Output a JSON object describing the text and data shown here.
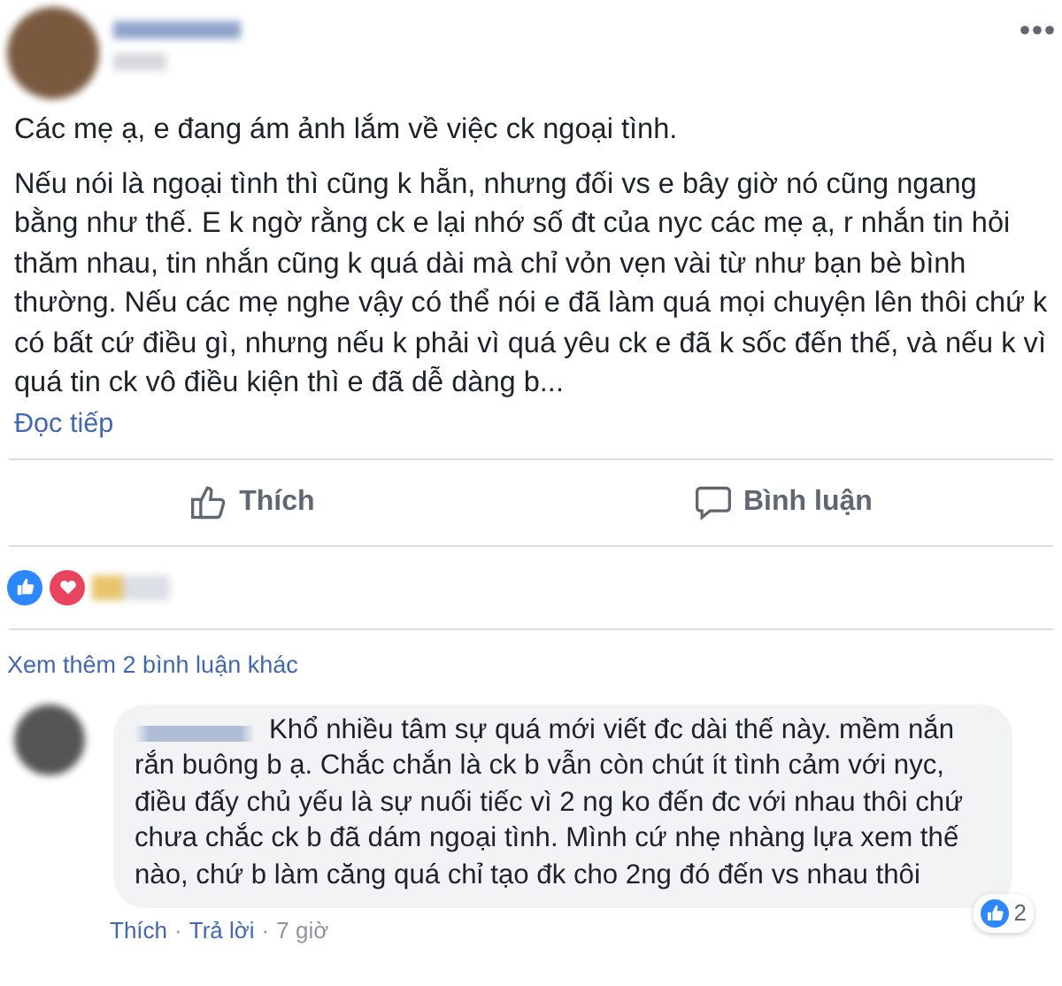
{
  "post": {
    "intro": "Các mẹ ạ, e đang ám ảnh lắm về việc ck ngoại tình.",
    "body": "Nếu nói là ngoại tình thì cũng k hẵn, nhưng đối vs e bây giờ nó cũng ngang bằng như thế. E k ngờ rằng ck e lại nhớ số đt của nyc các mẹ ạ, r nhắn tin hỏi thăm nhau, tin nhắn cũng k quá dài mà chỉ vỏn vẹn vài từ như bạn bè bình thường. Nếu các mẹ nghe vậy có thể nói e đã làm quá mọi chuyện lên thôi chứ k có bất cứ điều gì, nhưng nếu k phải vì quá yêu ck e đã k sốc đến thế, và nếu k vì quá tin ck vô điều kiện thì e đã dễ dàng b...",
    "read_more": "Đọc tiếp"
  },
  "actions": [
    {
      "kind": "like",
      "label": "Thích"
    },
    {
      "kind": "comment",
      "label": "Bình luận"
    }
  ],
  "more_comments": "Xem thêm 2 bình luận khác",
  "comment": {
    "text": "Khổ nhiều tâm sự quá mới viết đc dài thế này. mềm nắn rắn buông b ạ. Chắc chắn là ck b vẫn còn chút ít tình cảm với nyc, điều đấy chủ yếu là sự nuối tiếc vì 2 ng ko đến đc với nhau thôi chứ chưa chắc ck b đã dám ngoại tình. Mình cứ nhẹ nhàng lựa xem thế nào, chứ b làm căng quá chỉ tạo đk cho 2ng đó đến vs nhau thôi",
    "like_count": "2",
    "links": [
      {
        "kind": "link",
        "text": "Thích"
      },
      {
        "kind": "sep",
        "text": "·"
      },
      {
        "kind": "link",
        "text": "Trả lời"
      },
      {
        "kind": "sep",
        "text": "·"
      },
      {
        "kind": "time",
        "text": "7 giờ"
      }
    ]
  }
}
